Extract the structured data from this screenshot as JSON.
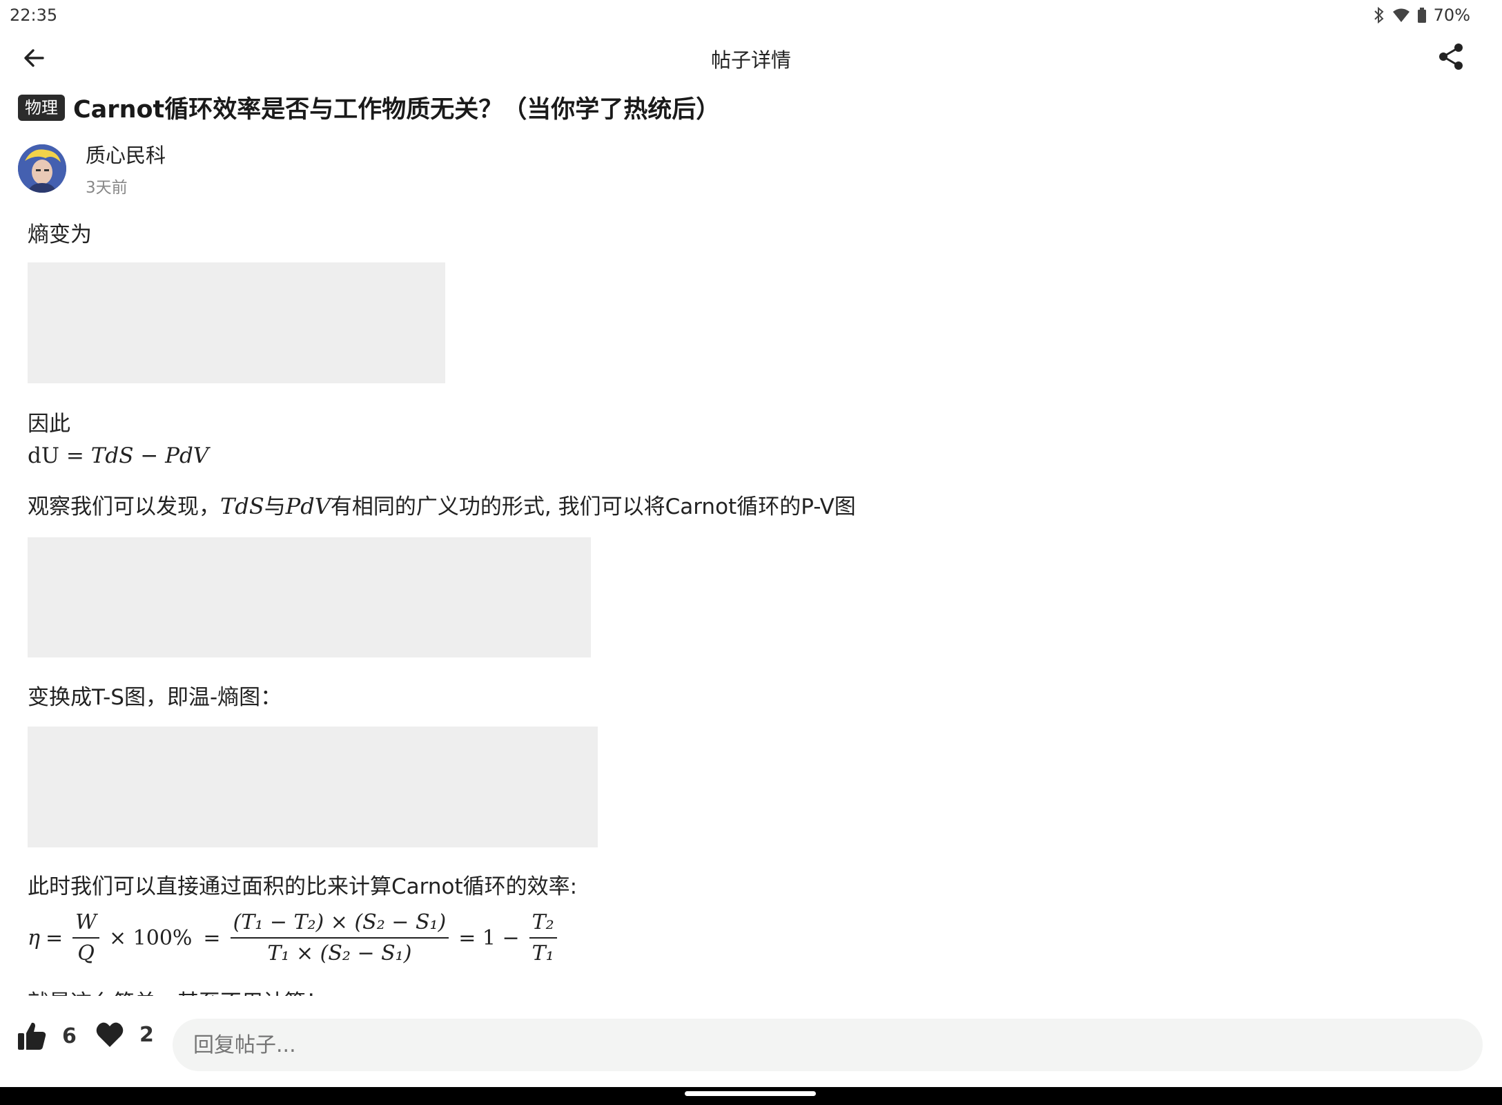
{
  "status_bar": {
    "time": "22:35",
    "battery": "70%",
    "icons": [
      "bluetooth-icon",
      "wifi-icon",
      "battery-icon"
    ]
  },
  "app_bar": {
    "title": "帖子详情",
    "back_icon": "arrow-left-icon",
    "share_icon": "share-icon"
  },
  "post": {
    "tag": "物理",
    "title": "Carnot循环效率是否与工作物质无关？（当你学了热统后）",
    "author": {
      "name": "质心民科",
      "time": "3天前"
    },
    "content": {
      "p1": "熵变为",
      "p2": "因此",
      "eq_du": {
        "lhs": "dU",
        "eq": "=",
        "t1": "TdS",
        "minus": "−",
        "t2": "PdV"
      },
      "p3_before": "观察我们可以发现，",
      "p3_m1": "TdS",
      "p3_mid": "与",
      "p3_m2": "PdV",
      "p3_after": "有相同的广义功的形式, 我们可以将Carnot循环的P-V图",
      "p4": "变换成T-S图，即温-熵图：",
      "p5": "此时我们可以直接通过面积的比来计算Carnot循环的效率:",
      "eq_eta": {
        "eta": "η",
        "eq": "=",
        "f1_num": "W",
        "f1_den": "Q",
        "times100": "× 100%",
        "f2_num": "(T₁ − T₂) × (S₂ − S₁)",
        "f2_den": "T₁ × (S₂ − S₁)",
        "one_minus": "= 1 −",
        "f3_num": "T₂",
        "f3_den": "T₁"
      },
      "p6_partial": "就是这么简单，甚至不用计算！"
    }
  },
  "bottom_bar": {
    "like_count": "6",
    "favorite_count": "2",
    "reply_placeholder": "回复帖子..."
  }
}
